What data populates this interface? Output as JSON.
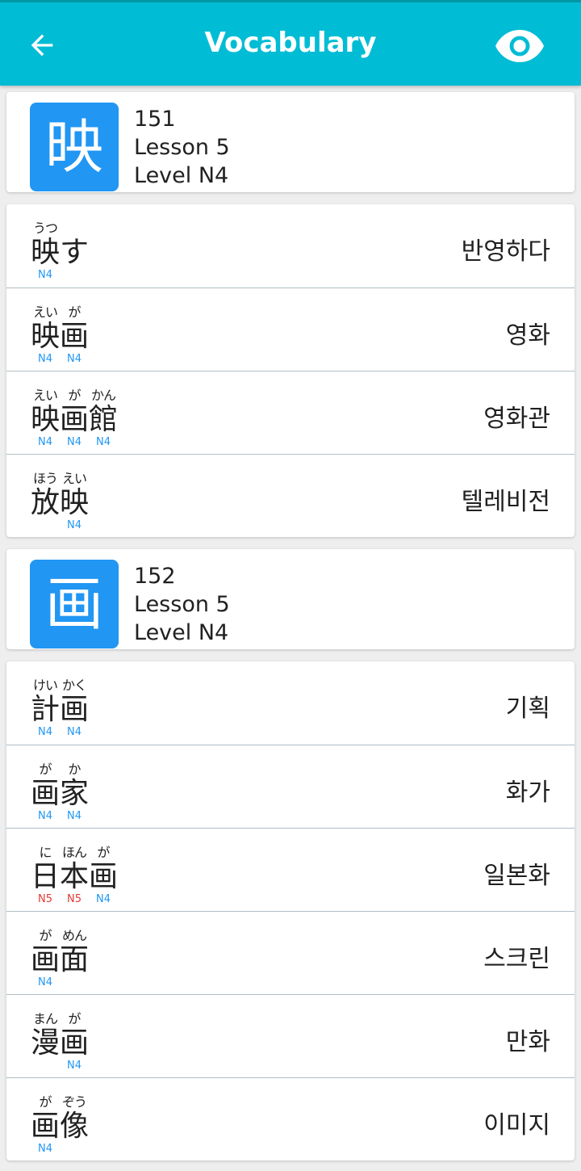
{
  "appbar": {
    "title": "Vocabulary",
    "back_icon": "arrow-back-icon",
    "eye_icon": "visibility-icon"
  },
  "colors": {
    "appbar": "#00bcd4",
    "kanji_box": "#2196f3",
    "level_n4": "#2196f3",
    "level_n5": "#e53935"
  },
  "groups": [
    {
      "kanji": {
        "char": "映",
        "number": "151",
        "lesson": "Lesson 5",
        "level": "Level N4"
      },
      "words": [
        {
          "meaning": "반영하다",
          "chars": [
            {
              "k": "映",
              "f": "うつ",
              "l": "N4"
            },
            {
              "k": "す",
              "f": "",
              "l": ""
            }
          ]
        },
        {
          "meaning": "영화",
          "chars": [
            {
              "k": "映",
              "f": "えい",
              "l": "N4"
            },
            {
              "k": "画",
              "f": "が",
              "l": "N4"
            }
          ]
        },
        {
          "meaning": "영화관",
          "chars": [
            {
              "k": "映",
              "f": "えい",
              "l": "N4"
            },
            {
              "k": "画",
              "f": "が",
              "l": "N4"
            },
            {
              "k": "館",
              "f": "かん",
              "l": "N4"
            }
          ]
        },
        {
          "meaning": "텔레비전",
          "chars": [
            {
              "k": "放",
              "f": "ほう",
              "l": ""
            },
            {
              "k": "映",
              "f": "えい",
              "l": "N4"
            }
          ]
        }
      ]
    },
    {
      "kanji": {
        "char": "画",
        "number": "152",
        "lesson": "Lesson 5",
        "level": "Level N4"
      },
      "words": [
        {
          "meaning": "기획",
          "chars": [
            {
              "k": "計",
              "f": "けい",
              "l": "N4"
            },
            {
              "k": "画",
              "f": "かく",
              "l": "N4"
            }
          ]
        },
        {
          "meaning": "화가",
          "chars": [
            {
              "k": "画",
              "f": "が",
              "l": "N4"
            },
            {
              "k": "家",
              "f": "か",
              "l": "N4"
            }
          ]
        },
        {
          "meaning": "일본화",
          "chars": [
            {
              "k": "日",
              "f": "に",
              "l": "N5"
            },
            {
              "k": "本",
              "f": "ほん",
              "l": "N5"
            },
            {
              "k": "画",
              "f": "が",
              "l": "N4"
            }
          ]
        },
        {
          "meaning": "스크린",
          "chars": [
            {
              "k": "画",
              "f": "が",
              "l": "N4"
            },
            {
              "k": "面",
              "f": "めん",
              "l": ""
            }
          ]
        },
        {
          "meaning": "만화",
          "chars": [
            {
              "k": "漫",
              "f": "まん",
              "l": ""
            },
            {
              "k": "画",
              "f": "が",
              "l": "N4"
            }
          ]
        },
        {
          "meaning": "이미지",
          "chars": [
            {
              "k": "画",
              "f": "が",
              "l": "N4"
            },
            {
              "k": "像",
              "f": "ぞう",
              "l": ""
            }
          ]
        }
      ]
    }
  ]
}
